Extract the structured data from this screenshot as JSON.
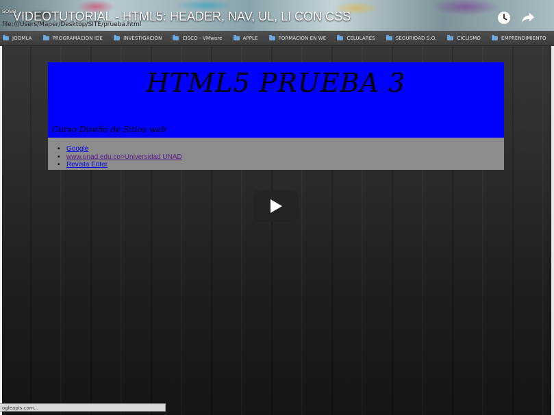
{
  "video": {
    "title": "VIDEOTUTORIAL - HTML5: HEADER, NAV, UL, LI CON CSS",
    "corner_label": "SOMB"
  },
  "browser": {
    "address": "file:///Users/Maper/Desktop/SITE/prueba.html",
    "bookmarks": [
      "JOOMLA",
      "PROGRAMACION IDE",
      "INVESTIGACION",
      "CISCO - VMware",
      "APPLE",
      "FORMACION EN WE",
      "CELULARES",
      "SEGURIDAD S.O.",
      "CICLISMO",
      "EMPRENDIMIENTO"
    ],
    "more": "»",
    "status": "ogleapis.com..."
  },
  "site": {
    "title": "HTML5 PRUEBA 3",
    "subtitle": "Curso Diseño de Sitios web",
    "nav_links": [
      "Google",
      "www.unad.edu.co>Universidad UNAD",
      "Revista Enter"
    ]
  },
  "colors": {
    "header_bg": "#0000ff",
    "nav_bg": "#8c8c8c",
    "link": "#0000ee",
    "visited_link": "#551a8b"
  },
  "icons": {
    "watch_later": "clock-icon",
    "share": "share-arrow-icon",
    "play": "play-icon",
    "folder": "folder-icon"
  }
}
